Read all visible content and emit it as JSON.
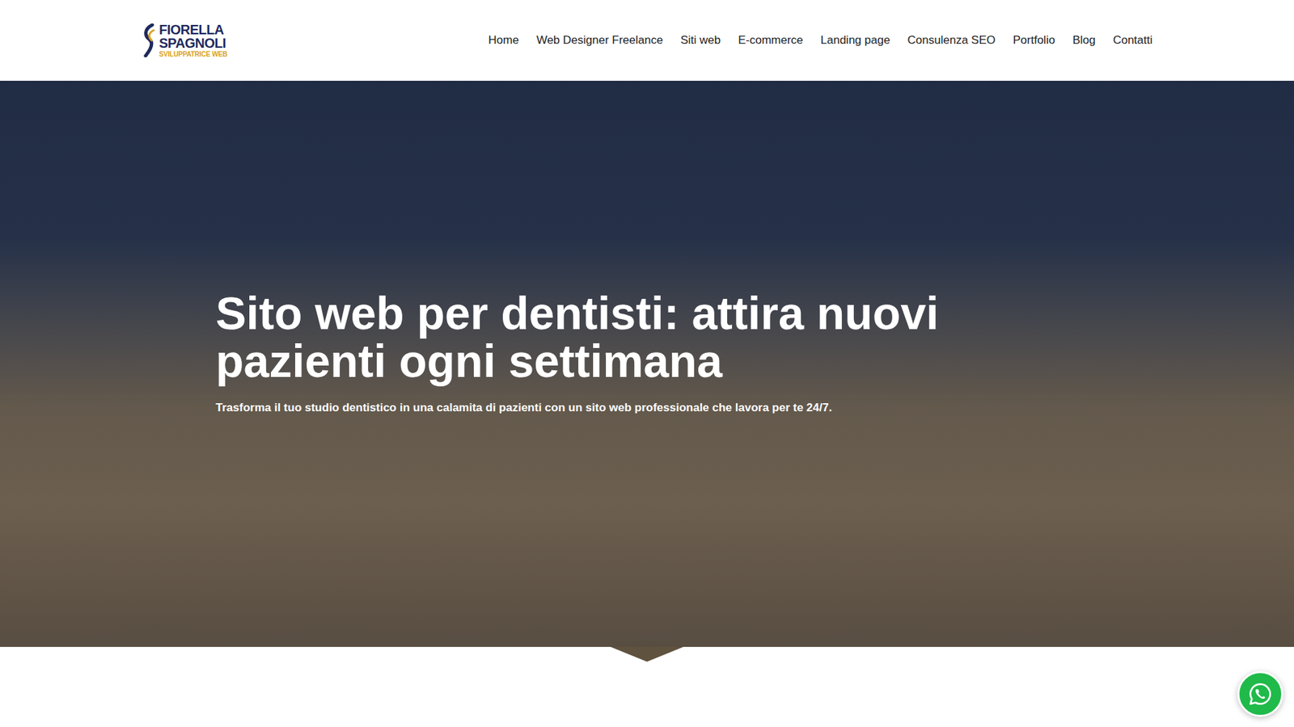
{
  "header": {
    "logo": {
      "line1": "FIORELLA",
      "line2": "SPAGNOLI",
      "tagline": "SVILUPPATRICE WEB"
    },
    "nav": [
      {
        "label": "Home",
        "selected": false
      },
      {
        "label": "Web Designer Freelance",
        "selected": false
      },
      {
        "label": "Siti web",
        "selected": false
      },
      {
        "label": "E-commerce",
        "selected": false
      },
      {
        "label": "Landing page",
        "selected": false
      },
      {
        "label": "Consulenza SEO",
        "selected": false
      },
      {
        "label": "Portfolio",
        "selected": false
      },
      {
        "label": "Blog",
        "selected": false
      },
      {
        "label": "Contatti",
        "selected": false
      }
    ]
  },
  "hero": {
    "title": "Sito web per dentisti: attira nuovi pazienti ogni settimana",
    "subtitle": "Trasforma il tuo studio dentistico in una calamita di pazienti con un sito web professionale che lavora per te 24/7."
  }
}
